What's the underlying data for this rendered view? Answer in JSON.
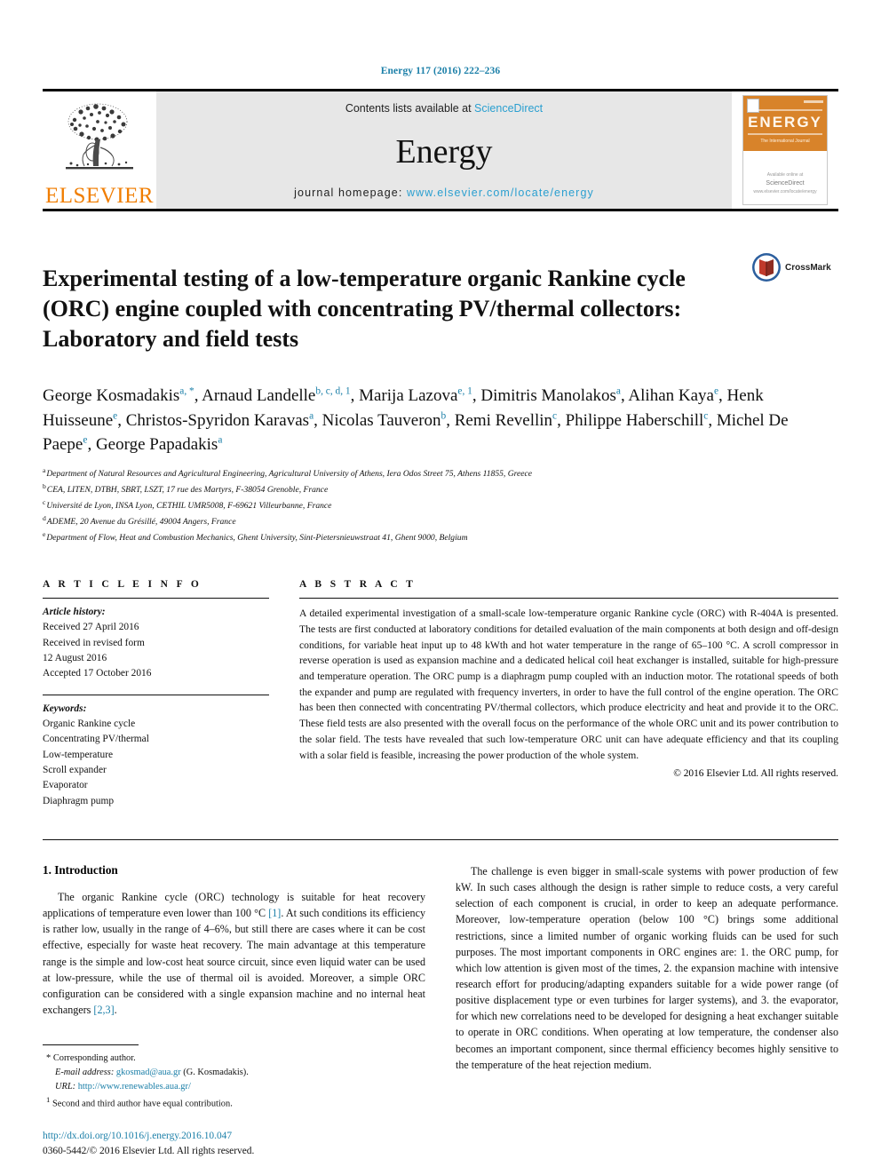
{
  "running_head": "Energy 117 (2016) 222–236",
  "masthead": {
    "publisher_name": "ELSEVIER",
    "contents_prefix": "Contents lists available at ",
    "contents_link": "ScienceDirect",
    "journal_name": "Energy",
    "homepage_prefix": "journal homepage: ",
    "homepage_link": "www.elsevier.com/locate/energy",
    "cover": {
      "title": "ENERGY",
      "subtitle": "The International Journal",
      "bottom_line_1": "Available online at",
      "bottom_line_2": "ScienceDirect",
      "bottom_line_3": "www.elsevier.com/locate/energy"
    }
  },
  "article": {
    "title_line_1": "Experimental testing of a low-temperature organic Rankine cycle",
    "title_line_2": "(ORC) engine coupled with concentrating PV/thermal collectors:",
    "title_line_3": "Laboratory and field tests",
    "crossmark_label": "CrossMark"
  },
  "authors": {
    "line_1": "George Kosmadakis",
    "line_1_sup": "a, *",
    "line_2": ", Arnaud Landelle",
    "line_2_sup": "b, c, d, 1",
    "line_3": ", Marija Lazova",
    "line_3_sup": "e, 1",
    "line_4": ", Dimitris Manolakos",
    "line_4_sup": "a",
    "line_5": ", Alihan Kaya",
    "line_5_sup": "e",
    "line_6": ", Henk Huisseune",
    "line_6_sup": "e",
    "line_7": ", Christos-Spyridon Karavas",
    "line_7_sup": "a",
    "line_8": ", Nicolas Tauveron",
    "line_8_sup": "b",
    "line_9": ", Remi Revellin",
    "line_9_sup": "c",
    "line_10": ", Philippe Haberschill",
    "line_10_sup": "c",
    "line_11": ", Michel De Paepe",
    "line_11_sup": "e",
    "line_12": ", George Papadakis",
    "line_12_sup": "a"
  },
  "affiliations": [
    {
      "mark": "a",
      "text": "Department of Natural Resources and Agricultural Engineering, Agricultural University of Athens, Iera Odos Street 75, Athens 11855, Greece"
    },
    {
      "mark": "b",
      "text": "CEA, LITEN, DTBH, SBRT, LSZT, 17 rue des Martyrs, F-38054 Grenoble, France"
    },
    {
      "mark": "c",
      "text": "Université de Lyon, INSA Lyon, CETHIL UMR5008, F-69621 Villeurbanne, France"
    },
    {
      "mark": "d",
      "text": "ADEME, 20 Avenue du Grésillé, 49004 Angers, France"
    },
    {
      "mark": "e",
      "text": "Department of Flow, Heat and Combustion Mechanics, Ghent University, Sint-Pietersnieuwstraat 41, Ghent 9000, Belgium"
    }
  ],
  "article_info": {
    "heading": "A R T I C L E    I N F O",
    "history_label": "Article history:",
    "history": [
      "Received 27 April 2016",
      "Received in revised form",
      "12 August 2016",
      "Accepted 17 October 2016"
    ],
    "keywords_label": "Keywords:",
    "keywords": [
      "Organic Rankine cycle",
      "Concentrating PV/thermal",
      "Low-temperature",
      "Scroll expander",
      "Evaporator",
      "Diaphragm pump"
    ]
  },
  "abstract": {
    "heading": "A B S T R A C T",
    "text": "A detailed experimental investigation of a small-scale low-temperature organic Rankine cycle (ORC) with R-404A is presented. The tests are first conducted at laboratory conditions for detailed evaluation of the main components at both design and off-design conditions, for variable heat input up to 48 kWth and hot water temperature in the range of 65–100 °C. A scroll compressor in reverse operation is used as expansion machine and a dedicated helical coil heat exchanger is installed, suitable for high-pressure and temperature operation. The ORC pump is a diaphragm pump coupled with an induction motor. The rotational speeds of both the expander and pump are regulated with frequency inverters, in order to have the full control of the engine operation. The ORC has been then connected with concentrating PV/thermal collectors, which produce electricity and heat and provide it to the ORC. These field tests are also presented with the overall focus on the performance of the whole ORC unit and its power contribution to the solar field. The tests have revealed that such low-temperature ORC unit can have adequate efficiency and that its coupling with a solar field is feasible, increasing the power production of the whole system.",
    "copyright": "© 2016 Elsevier Ltd. All rights reserved."
  },
  "introduction": {
    "section_number": "1.",
    "section_title": "Introduction",
    "left_para_part_1": "The organic Rankine cycle (ORC) technology is suitable for heat recovery applications of temperature even lower than 100 °C ",
    "left_citation_1": "[1]",
    "left_para_part_2": ". At such conditions its efficiency is rather low, usually in the range of 4–6%, but still there are cases where it can be cost effective, especially for waste heat recovery. The main advantage at this temperature range is the simple and low-cost heat source circuit, since even liquid water can be used at low-pressure, while the use of thermal oil is avoided. Moreover, a simple ORC configuration can be considered with a single expansion machine and no internal heat exchangers ",
    "left_citation_2": "[2,3]",
    "left_para_part_3": ".",
    "right_para": "The challenge is even bigger in small-scale systems with power production of few kW. In such cases although the design is rather simple to reduce costs, a very careful selection of each component is crucial, in order to keep an adequate performance. Moreover, low-temperature operation (below 100 °C) brings some additional restrictions, since a limited number of organic working fluids can be used for such purposes. The most important components in ORC engines are: 1. the ORC pump, for which low attention is given most of the times, 2. the expansion machine with intensive research effort for producing/adapting expanders suitable for a wide power range (of positive displacement type or even turbines for larger systems), and 3. the evaporator, for which new correlations need to be developed for designing a heat exchanger suitable to operate in ORC conditions. When operating at low temperature, the condenser also becomes an important component, since thermal efficiency becomes highly sensitive to the temperature of the heat rejection medium."
  },
  "footnotes": {
    "corresponding_mark": "*",
    "corresponding_text": "Corresponding author.",
    "email_label": "E-mail address:",
    "email": "gkosmad@aua.gr",
    "email_owner": "(G. Kosmadakis).",
    "url_label": "URL:",
    "url": "http://www.renewables.aua.gr/",
    "note_mark": "1",
    "note_text": "Second and third author have equal contribution."
  },
  "footer": {
    "doi": "http://dx.doi.org/10.1016/j.energy.2016.10.047",
    "issn_line": "0360-5442/© 2016 Elsevier Ltd. All rights reserved."
  },
  "colors": {
    "link_blue": "#1b7fa8",
    "sciencedirect_blue": "#2a9fd0",
    "elsevier_orange": "#f07d00",
    "cover_orange": "#d8832a"
  }
}
